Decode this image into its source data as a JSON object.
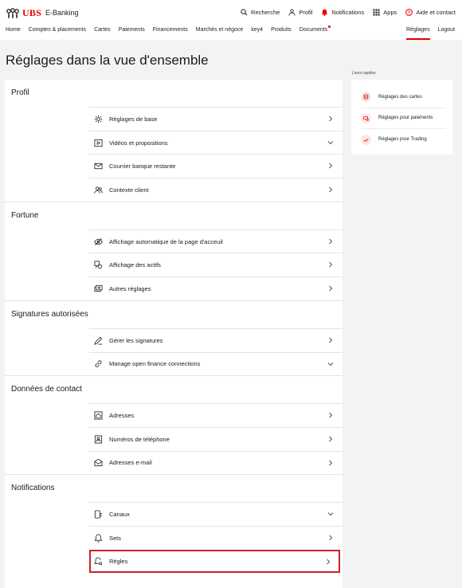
{
  "header": {
    "brand": "UBS",
    "app_name": "E-Banking",
    "actions": [
      {
        "label": "Recherche",
        "icon": "search-icon"
      },
      {
        "label": "Profil",
        "icon": "profile-icon"
      },
      {
        "label": "Notifications",
        "icon": "bell-icon"
      },
      {
        "label": "Apps",
        "icon": "apps-grid-icon"
      },
      {
        "label": "Aide et contact",
        "icon": "help-icon"
      }
    ]
  },
  "nav": {
    "items": [
      "Home",
      "Comptes & placements",
      "Cartes",
      "Paiements",
      "Financements",
      "Marchés et négoce",
      "key4",
      "Produits",
      "Documents"
    ],
    "right": [
      "Réglages",
      "Logout"
    ],
    "active": "Réglages"
  },
  "page": {
    "title": "Réglages dans la vue d'ensemble"
  },
  "sections": [
    {
      "title": "Profil",
      "items": [
        {
          "label": "Réglages de base",
          "icon": "gear-icon",
          "chevron": "right"
        },
        {
          "label": "Vidéos et propositions",
          "icon": "video-icon",
          "chevron": "down"
        },
        {
          "label": "Courrier banque restante",
          "icon": "mail-icon",
          "chevron": "right"
        },
        {
          "label": "Contexte client",
          "icon": "users-icon",
          "chevron": "right"
        }
      ]
    },
    {
      "title": "Fortune",
      "items": [
        {
          "label": "Affichage automatique de la page d'acceuil",
          "icon": "eye-off-icon",
          "chevron": "right"
        },
        {
          "label": "Affichage des actifs",
          "icon": "assets-icon",
          "chevron": "right"
        },
        {
          "label": "Autres réglages",
          "icon": "money-icon",
          "chevron": "right"
        }
      ]
    },
    {
      "title": "Signatures autorisées",
      "items": [
        {
          "label": "Gérer les signatures",
          "icon": "signature-icon",
          "chevron": "right"
        },
        {
          "label": "Manage open finance connections",
          "icon": "link-icon",
          "chevron": "down"
        }
      ]
    },
    {
      "title": "Données de contact",
      "items": [
        {
          "label": "Adresses",
          "icon": "home-icon",
          "chevron": "right"
        },
        {
          "label": "Numéros de téléphone",
          "icon": "contact-card-icon",
          "chevron": "right"
        },
        {
          "label": "Adresses e-mail",
          "icon": "email-icon",
          "chevron": "right"
        }
      ]
    },
    {
      "title": "Notifications",
      "items": [
        {
          "label": "Canaux",
          "icon": "channels-icon",
          "chevron": "down"
        },
        {
          "label": "Sets",
          "icon": "bell-icon",
          "chevron": "right"
        },
        {
          "label": "Règles",
          "icon": "bell-settings-icon",
          "chevron": "right",
          "highlighted": true
        }
      ]
    }
  ],
  "quick_links": {
    "label": "Liens rapides",
    "items": [
      {
        "label": "Réglages des cartes",
        "icon": "card-settings-icon"
      },
      {
        "label": "Réglages pour paiements",
        "icon": "payment-settings-icon"
      },
      {
        "label": "Réglages pour Trading",
        "icon": "trading-icon"
      }
    ]
  },
  "colors": {
    "accent": "#e60000",
    "highlight_border": "#d21f1f",
    "background": "#f3f3f3"
  }
}
